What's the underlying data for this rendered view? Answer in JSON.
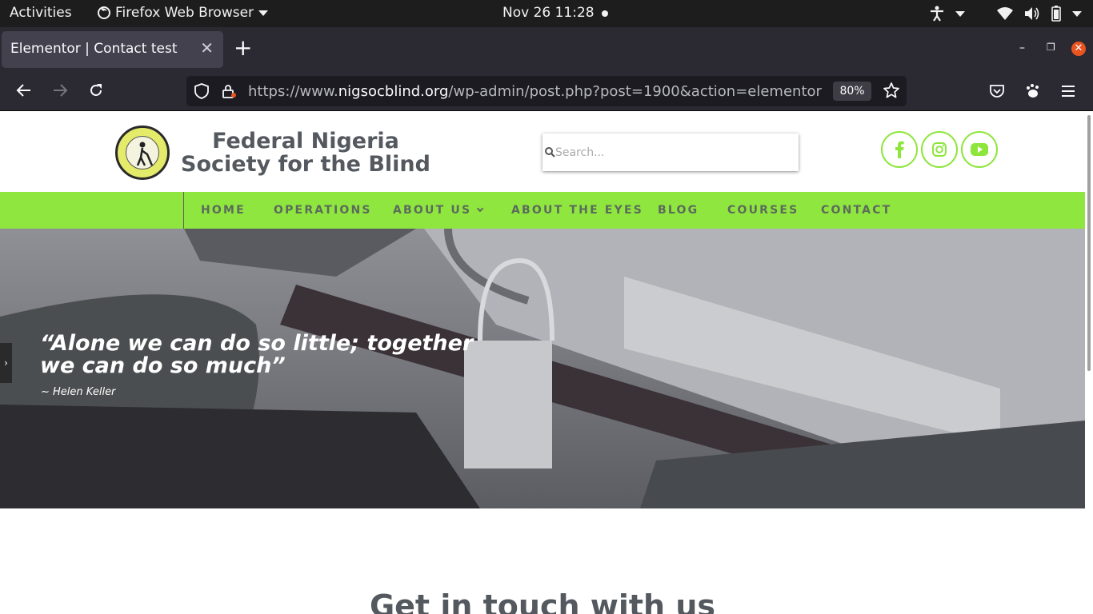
{
  "topbar": {
    "activities": "Activities",
    "app_name": "Firefox Web Browser",
    "clock": "Nov 26  11:28"
  },
  "browser": {
    "tab_title": "Elementor | Contact test",
    "url_prefix": "https://www.",
    "url_host": "nigsocblind.org",
    "url_path": "/wp-admin/post.php?post=1900&action=elementor",
    "zoom": "80%",
    "accent": "#e95420"
  },
  "site": {
    "title": "Federal Nigeria Society for the Blind",
    "search_placeholder": "Search...",
    "social_icons": [
      "facebook-icon",
      "instagram-icon",
      "youtube-icon"
    ],
    "accent_green": "#8fe63f",
    "nav": [
      "HOME",
      "OPERATIONS",
      "ABOUT US",
      "ABOUT THE EYES",
      "BLOG",
      "COURSES",
      "CONTACT"
    ],
    "hero_quote": "“Alone we can do so little; together we can do so much”",
    "hero_author": "~ Helen Keller",
    "section_heading": "Get in touch with us"
  }
}
